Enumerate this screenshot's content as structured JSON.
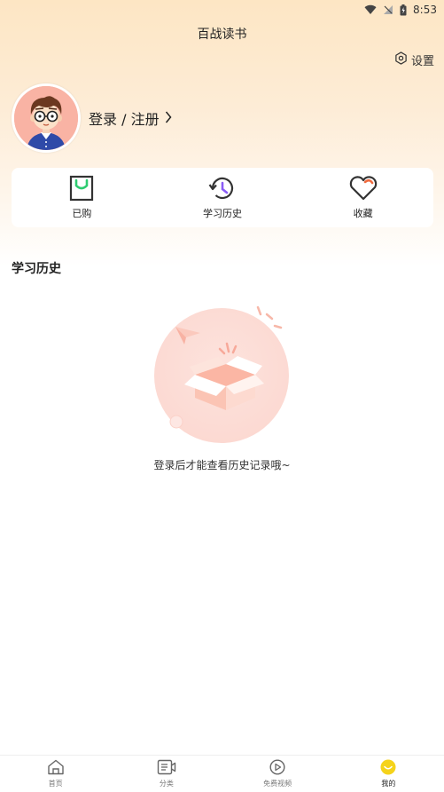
{
  "status_bar": {
    "time": "8:53"
  },
  "header": {
    "title": "百战读书"
  },
  "settings": {
    "label": "设置"
  },
  "profile": {
    "login_label": "登录 / 注册"
  },
  "quick_actions": [
    {
      "label": "已购",
      "icon": "shopping-bag-icon"
    },
    {
      "label": "学习历史",
      "icon": "history-icon"
    },
    {
      "label": "收藏",
      "icon": "heart-icon"
    }
  ],
  "history": {
    "section_title": "学习历史",
    "empty_text": "登录后才能查看历史记录哦~"
  },
  "tabbar": {
    "items": [
      {
        "label": "首页",
        "icon": "home-icon"
      },
      {
        "label": "分类",
        "icon": "category-icon"
      },
      {
        "label": "免费视频",
        "icon": "play-icon"
      },
      {
        "label": "我的",
        "icon": "profile-icon"
      }
    ],
    "active_index": 3
  },
  "colors": {
    "accent_green": "#2ecc71",
    "accent_purple": "#8a5cf6",
    "accent_orange": "#f06b3f",
    "active_tab": "#f5d31b",
    "header_gradient_top": "#fde6c4"
  }
}
